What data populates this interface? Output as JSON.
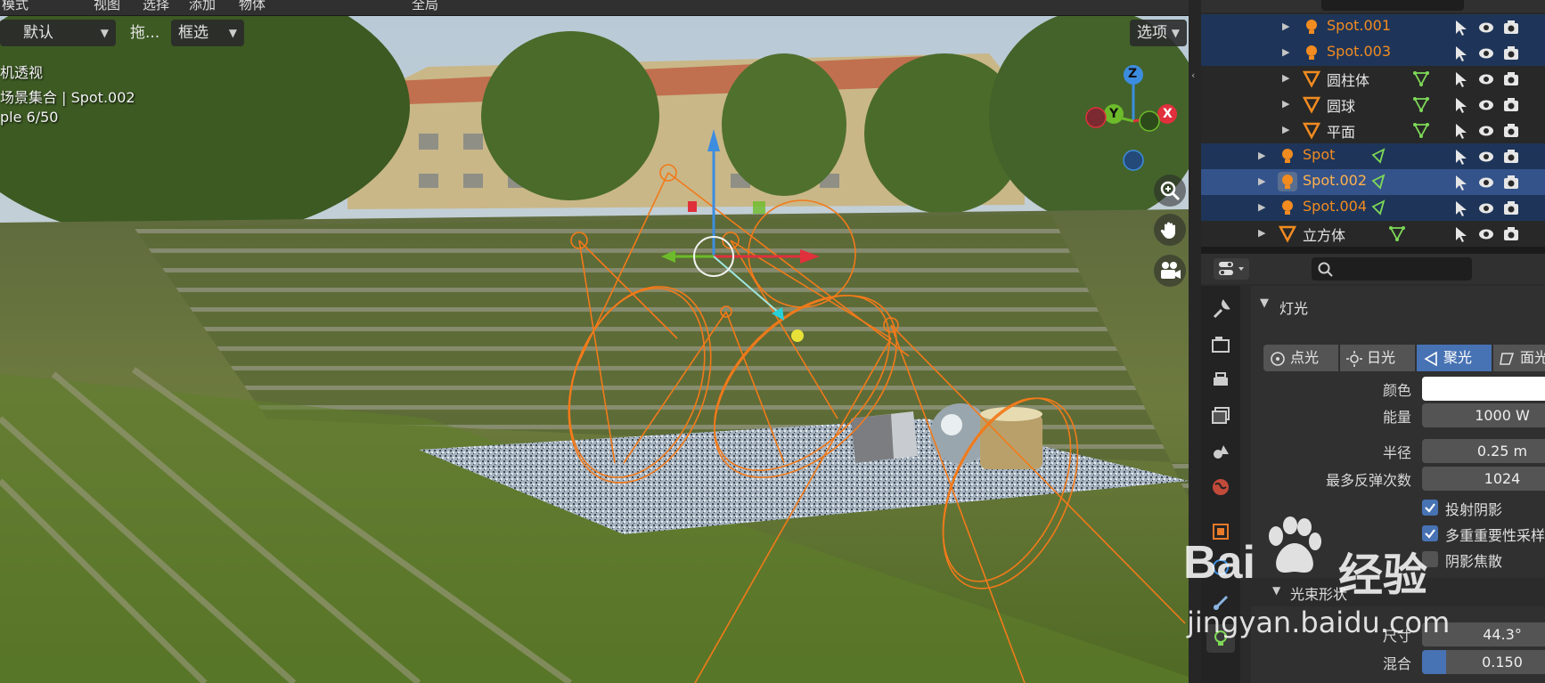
{
  "menu": {
    "mode": "模式",
    "view": "视图",
    "select": "选择",
    "add": "添加",
    "object": "物体",
    "orientation": "全局"
  },
  "header": {
    "default_label": "默认",
    "drag_label": "拖...",
    "select_box_label": "框选",
    "options_label": "选项"
  },
  "viewport_info": {
    "line1": "机透视",
    "line2": "场景集合 | Spot.002",
    "line3": "ple 6/50"
  },
  "gizmo": {
    "z": "Z",
    "y": "Y",
    "x": "X"
  },
  "outliner": {
    "rows": [
      {
        "label": "Spot.001",
        "kind": "light",
        "indent": 1,
        "highlight": true,
        "selected": false,
        "color": "#f28b20",
        "data_icon": false
      },
      {
        "label": "Spot.003",
        "kind": "light",
        "indent": 1,
        "highlight": true,
        "selected": false,
        "color": "#f28b20",
        "data_icon": false
      },
      {
        "label": "圆柱体",
        "kind": "mesh",
        "indent": 1,
        "highlight": false,
        "selected": false,
        "color": "#e6e6e6",
        "data_icon": true
      },
      {
        "label": "圆球",
        "kind": "mesh",
        "indent": 1,
        "highlight": false,
        "selected": false,
        "color": "#e6e6e6",
        "data_icon": true
      },
      {
        "label": "平面",
        "kind": "mesh",
        "indent": 1,
        "highlight": false,
        "selected": false,
        "color": "#e6e6e6",
        "data_icon": true
      },
      {
        "label": "Spot",
        "kind": "light",
        "indent": 0,
        "highlight": true,
        "selected": false,
        "color": "#f28b20",
        "data_icon": true
      },
      {
        "label": "Spot.002",
        "kind": "light",
        "indent": 0,
        "highlight": true,
        "selected": true,
        "color": "#ffb24d",
        "data_icon": true
      },
      {
        "label": "Spot.004",
        "kind": "light",
        "indent": 0,
        "highlight": true,
        "selected": false,
        "color": "#f28b20",
        "data_icon": true
      },
      {
        "label": "立方体",
        "kind": "mesh",
        "indent": 0,
        "highlight": false,
        "selected": false,
        "color": "#e6e6e6",
        "data_icon": true
      }
    ]
  },
  "properties": {
    "panel_title": "灯光",
    "light_types": [
      "点光",
      "日光",
      "聚光",
      "面光"
    ],
    "selected_type": "聚光",
    "color_label": "颜色",
    "energy_label": "能量",
    "energy_value": "1000 W",
    "radius_label": "半径",
    "radius_value": "0.25 m",
    "bounces_label": "最多反弹次数",
    "bounces_value": "1024",
    "cast_shadow": "投射阴影",
    "mis": "多重重要性采样",
    "shadow_caustics": "阴影焦散",
    "beam_shape": "光束形状",
    "size_label": "尺寸",
    "size_value": "44.3°",
    "blend_label": "混合",
    "blend_value": "0.150",
    "blend_fraction": 0.15
  },
  "watermark": {
    "brand_text": "Bai",
    "brand_suffix": "经验",
    "url": "jingyan.baidu.com"
  },
  "colors": {
    "accent": "#4772b3",
    "light_orange": "#f28b20",
    "outliner_highlight": "#1e3559",
    "outliner_selected": "#34538a"
  }
}
